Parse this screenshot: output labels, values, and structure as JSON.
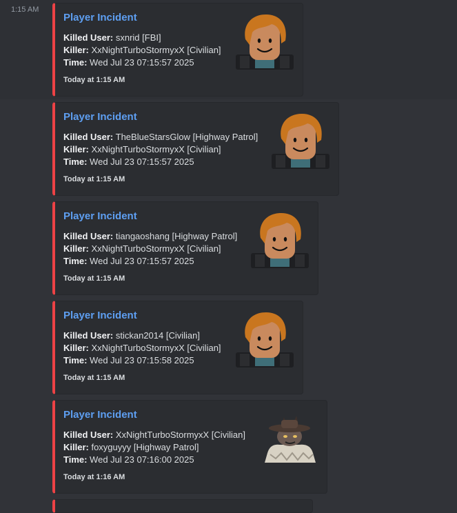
{
  "message": {
    "timestamp": "1:15 AM"
  },
  "colors": {
    "embed_border": "#ed4245",
    "title": "#5e9ff2",
    "background": "#313338",
    "embed_bg": "#2b2d31"
  },
  "embeds": [
    {
      "title": "Player Incident",
      "killed_label": "Killed User:",
      "killed_value": " sxnrid [FBI]",
      "killer_label": "Killer:",
      "killer_value": " XxNightTurboStormyxX [Civilian]",
      "time_label": "Time:",
      "time_value": " Wed Jul 23 07:15:57 2025",
      "footer": "Today at 1:15 AM",
      "thumbnail": "roblox-avatar-icon"
    },
    {
      "title": "Player Incident",
      "killed_label": "Killed User:",
      "killed_value": " TheBlueStarsGlow [Highway Patrol]",
      "killer_label": "Killer:",
      "killer_value": " XxNightTurboStormyxX [Civilian]",
      "time_label": "Time:",
      "time_value": " Wed Jul 23 07:15:57 2025",
      "footer": "Today at 1:15 AM",
      "thumbnail": "roblox-avatar-icon"
    },
    {
      "title": "Player Incident",
      "killed_label": "Killed User:",
      "killed_value": " tiangaoshang [Highway Patrol]",
      "killer_label": "Killer:",
      "killer_value": " XxNightTurboStormyxX [Civilian]",
      "time_label": "Time:",
      "time_value": " Wed Jul 23 07:15:57 2025",
      "footer": "Today at 1:15 AM",
      "thumbnail": "roblox-avatar-icon"
    },
    {
      "title": "Player Incident",
      "killed_label": "Killed User:",
      "killed_value": " stickan2014 [Civilian]",
      "killer_label": "Killer:",
      "killer_value": " XxNightTurboStormyxX [Civilian]",
      "time_label": "Time:",
      "time_value": " Wed Jul 23 07:15:58 2025",
      "footer": "Today at 1:15 AM",
      "thumbnail": "roblox-avatar-icon"
    },
    {
      "title": "Player Incident",
      "killed_label": "Killed User:",
      "killed_value": " XxNightTurboStormyxX [Civilian]",
      "killer_label": "Killer:",
      "killer_value": " foxyguyyy [Highway Patrol]",
      "time_label": "Time:",
      "time_value": " Wed Jul 23 07:16:00 2025",
      "footer": "Today at 1:16 AM",
      "thumbnail": "cowboy-avatar-icon"
    }
  ]
}
